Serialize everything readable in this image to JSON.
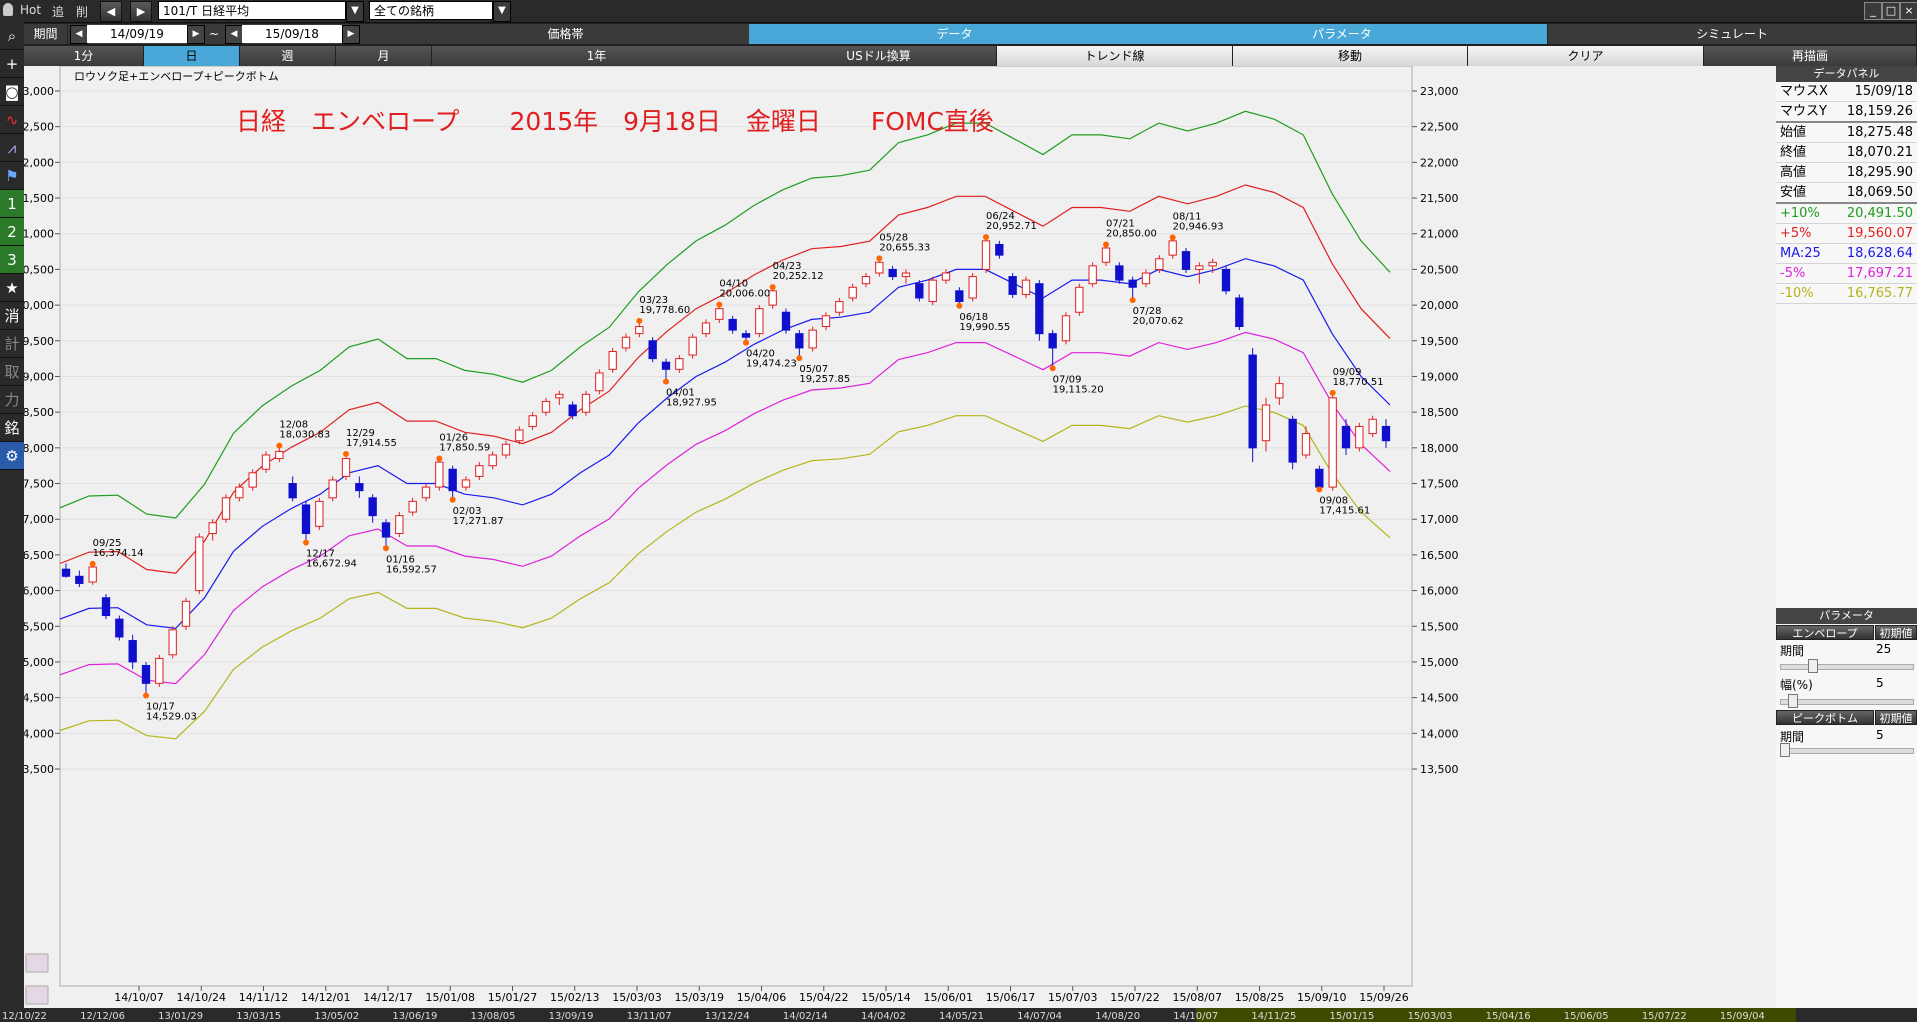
{
  "topbar": {
    "hot": "Hot",
    "tsui": "追",
    "sakujo": "削",
    "symbol": "101/T 日経平均",
    "filter": "全ての銘柄",
    "tab_data": "データ",
    "tab_params": "パラメータ",
    "tab_simulate": "シミュレート"
  },
  "period": {
    "label": "期間",
    "from": "14/09/19",
    "sep": "~",
    "to": "15/09/18",
    "price_band": "価格帯"
  },
  "row3": {
    "b1": "1分",
    "b2": "日",
    "b3": "週",
    "b4": "月",
    "b5": "1年",
    "b6": "USドル換算",
    "b7": "トレンド線",
    "b8": "移動",
    "b9": "クリア",
    "b10": "再描画"
  },
  "left_tools": {
    "t1": "1",
    "t2": "2",
    "t3": "3",
    "t4": "消",
    "t5": "計",
    "t6": "取",
    "t7": "力",
    "t8": "銘"
  },
  "chart": {
    "mode": "ロウソク足+エンベロープ+ピークボトム",
    "title": "日経　エンベロープ　　2015年　9月18日　金曜日　　FOMC直後"
  },
  "colors": {
    "up": "#e02020",
    "down": "#1010cc",
    "ma": "#1a1aee",
    "p5": "#e02020",
    "p10": "#1e9e1e",
    "m5": "#dd22dd",
    "m10": "#b5b51a"
  },
  "chart_data": {
    "type": "candlestick",
    "title": "日経　エンベロープ　　2015年　9月18日　金曜日　　FOMC直後",
    "ylim": [
      13500,
      23000
    ],
    "yticks": [
      "23,000",
      "22,500",
      "22,000",
      "21,500",
      "21,000",
      "20,500",
      "20,000",
      "19,500",
      "19,000",
      "18,500",
      "18,000",
      "17,500",
      "17,000",
      "16,500",
      "16,000",
      "15,500",
      "15,000",
      "14,500",
      "14,000",
      "13,500"
    ],
    "xticks": [
      "14/10/07",
      "14/10/24",
      "14/11/12",
      "14/12/01",
      "14/12/17",
      "15/01/08",
      "15/01/27",
      "15/02/13",
      "15/03/03",
      "15/03/19",
      "15/04/06",
      "15/04/22",
      "15/05/14",
      "15/06/01",
      "15/06/17",
      "15/07/03",
      "15/07/22",
      "15/08/07",
      "15/08/25",
      "15/09/10",
      "15/09/26"
    ],
    "overview_ticks": [
      "12/10/22",
      "12/12/06",
      "13/01/29",
      "13/03/15",
      "13/05/02",
      "13/06/19",
      "13/08/05",
      "13/09/19",
      "13/11/07",
      "13/12/24",
      "14/02/14",
      "14/04/02",
      "14/05/21",
      "14/07/04",
      "14/08/20",
      "14/10/07",
      "14/11/25",
      "15/01/15",
      "15/03/03",
      "15/04/16",
      "15/06/05",
      "15/07/22",
      "15/09/04"
    ],
    "ma_period": 25,
    "ma_series": [
      15600,
      15750,
      15760,
      15520,
      15470,
      15900,
      16550,
      16900,
      17150,
      17350,
      17650,
      17750,
      17500,
      17500,
      17350,
      17300,
      17200,
      17350,
      17650,
      17900,
      18350,
      18700,
      19000,
      19200,
      19450,
      19650,
      19800,
      19830,
      19900,
      20250,
      20350,
      20500,
      20500,
      20300,
      20100,
      20350,
      20350,
      20300,
      20500,
      20400,
      20500,
      20650,
      20550,
      20350,
      19600,
      19000,
      18600
    ],
    "peaks": [
      {
        "date": "09/25",
        "value": "16,374.14"
      },
      {
        "date": "10/17",
        "value": "14,529.03"
      },
      {
        "date": "12/08",
        "value": "18,030.83"
      },
      {
        "date": "12/17",
        "value": "16,672.94"
      },
      {
        "date": "12/29",
        "value": "17,914.55"
      },
      {
        "date": "01/16",
        "value": "16,592.57"
      },
      {
        "date": "01/26",
        "value": "17,850.59"
      },
      {
        "date": "02/03",
        "value": "17,271.87"
      },
      {
        "date": "03/23",
        "value": "19,778.60"
      },
      {
        "date": "04/01",
        "value": "18,927.95"
      },
      {
        "date": "04/10",
        "value": "20,006.00"
      },
      {
        "date": "04/20",
        "value": "19,474.23"
      },
      {
        "date": "04/23",
        "value": "20,252.12"
      },
      {
        "date": "05/07",
        "value": "19,257.85"
      },
      {
        "date": "05/28",
        "value": "20,655.33"
      },
      {
        "date": "06/18",
        "value": "19,990.55"
      },
      {
        "date": "06/24",
        "value": "20,952.71"
      },
      {
        "date": "07/09",
        "value": "19,115.20"
      },
      {
        "date": "07/21",
        "value": "20,850.00"
      },
      {
        "date": "07/28",
        "value": "20,070.62"
      },
      {
        "date": "08/11",
        "value": "20,946.93"
      },
      {
        "date": "09/08",
        "value": "17,415.61"
      },
      {
        "date": "09/09",
        "value": "18,770.51"
      }
    ],
    "peak_values": [
      16374.14,
      14529.03,
      18030.83,
      16672.94,
      17914.55,
      16592.57,
      17850.59,
      17271.87,
      19778.6,
      18927.95,
      20006.0,
      19474.23,
      20252.12,
      19257.85,
      20655.33,
      19990.55,
      20952.71,
      19115.2,
      20850.0,
      20070.62,
      20946.93,
      17415.61,
      18770.51
    ],
    "candles": [
      [
        16300,
        16380,
        16180,
        16200
      ],
      [
        16200,
        16280,
        16050,
        16100
      ],
      [
        16120,
        16374,
        16080,
        16330
      ],
      [
        15900,
        15950,
        15600,
        15650
      ],
      [
        15600,
        15650,
        15300,
        15350
      ],
      [
        15300,
        15380,
        14900,
        15000
      ],
      [
        14950,
        15000,
        14529,
        14700
      ],
      [
        14700,
        15100,
        14650,
        15050
      ],
      [
        15100,
        15500,
        15050,
        15450
      ],
      [
        15500,
        15900,
        15450,
        15850
      ],
      [
        16000,
        16800,
        15950,
        16750
      ],
      [
        16800,
        17000,
        16700,
        16950
      ],
      [
        17000,
        17350,
        16950,
        17300
      ],
      [
        17300,
        17500,
        17250,
        17450
      ],
      [
        17450,
        17700,
        17400,
        17650
      ],
      [
        17700,
        17950,
        17650,
        17900
      ],
      [
        17850,
        18030,
        17800,
        17950
      ],
      [
        17500,
        17600,
        17250,
        17300
      ],
      [
        17200,
        17250,
        16672,
        16800
      ],
      [
        16900,
        17300,
        16850,
        17250
      ],
      [
        17300,
        17600,
        17250,
        17550
      ],
      [
        17600,
        17914,
        17550,
        17850
      ],
      [
        17500,
        17600,
        17300,
        17400
      ],
      [
        17300,
        17350,
        16950,
        17050
      ],
      [
        16950,
        17000,
        16592,
        16750
      ],
      [
        16800,
        17100,
        16750,
        17050
      ],
      [
        17100,
        17300,
        17050,
        17250
      ],
      [
        17300,
        17500,
        17250,
        17450
      ],
      [
        17450,
        17850,
        17400,
        17800
      ],
      [
        17700,
        17750,
        17271,
        17400
      ],
      [
        17450,
        17600,
        17400,
        17550
      ],
      [
        17600,
        17800,
        17550,
        17750
      ],
      [
        17750,
        17950,
        17700,
        17900
      ],
      [
        17900,
        18100,
        17850,
        18050
      ],
      [
        18100,
        18300,
        18050,
        18250
      ],
      [
        18300,
        18500,
        18250,
        18450
      ],
      [
        18500,
        18700,
        18450,
        18650
      ],
      [
        18700,
        18800,
        18600,
        18750
      ],
      [
        18600,
        18650,
        18400,
        18450
      ],
      [
        18500,
        18800,
        18450,
        18750
      ],
      [
        18800,
        19100,
        18750,
        19050
      ],
      [
        19100,
        19400,
        19050,
        19350
      ],
      [
        19400,
        19600,
        19350,
        19550
      ],
      [
        19600,
        19778,
        19550,
        19700
      ],
      [
        19500,
        19550,
        19200,
        19250
      ],
      [
        19200,
        19250,
        18927,
        19100
      ],
      [
        19100,
        19300,
        19050,
        19250
      ],
      [
        19300,
        19600,
        19250,
        19550
      ],
      [
        19600,
        19800,
        19550,
        19750
      ],
      [
        19800,
        20006,
        19750,
        19950
      ],
      [
        19800,
        19850,
        19600,
        19650
      ],
      [
        19600,
        19650,
        19474,
        19550
      ],
      [
        19600,
        20000,
        19550,
        19950
      ],
      [
        20000,
        20252,
        19950,
        20200
      ],
      [
        19900,
        19950,
        19600,
        19650
      ],
      [
        19600,
        19650,
        19257,
        19400
      ],
      [
        19400,
        19700,
        19350,
        19650
      ],
      [
        19700,
        19900,
        19650,
        19850
      ],
      [
        19900,
        20100,
        19850,
        20050
      ],
      [
        20100,
        20300,
        20050,
        20250
      ],
      [
        20300,
        20450,
        20250,
        20400
      ],
      [
        20450,
        20655,
        20400,
        20600
      ],
      [
        20500,
        20550,
        20350,
        20400
      ],
      [
        20400,
        20500,
        20300,
        20450
      ],
      [
        20300,
        20350,
        20050,
        20100
      ],
      [
        20050,
        20400,
        20000,
        20350
      ],
      [
        20350,
        20500,
        20300,
        20450
      ],
      [
        20200,
        20250,
        19990,
        20050
      ],
      [
        20100,
        20450,
        20050,
        20400
      ],
      [
        20500,
        20952,
        20450,
        20900
      ],
      [
        20850,
        20900,
        20650,
        20700
      ],
      [
        20400,
        20450,
        20100,
        20150
      ],
      [
        20150,
        20400,
        20100,
        20350
      ],
      [
        20300,
        20350,
        19500,
        19600
      ],
      [
        19600,
        19650,
        19115,
        19400
      ],
      [
        19500,
        19900,
        19450,
        19850
      ],
      [
        19900,
        20300,
        19850,
        20250
      ],
      [
        20300,
        20600,
        20250,
        20550
      ],
      [
        20600,
        20850,
        20550,
        20800
      ],
      [
        20550,
        20600,
        20300,
        20350
      ],
      [
        20350,
        20400,
        20070,
        20250
      ],
      [
        20300,
        20500,
        20250,
        20450
      ],
      [
        20500,
        20700,
        20450,
        20650
      ],
      [
        20700,
        20946,
        20650,
        20900
      ],
      [
        20750,
        20800,
        20450,
        20500
      ],
      [
        20500,
        20600,
        20300,
        20550
      ],
      [
        20550,
        20650,
        20450,
        20600
      ],
      [
        20500,
        20550,
        20150,
        20200
      ],
      [
        20100,
        20150,
        19650,
        19700
      ],
      [
        19300,
        19400,
        17800,
        18000
      ],
      [
        18100,
        18700,
        17950,
        18600
      ],
      [
        18700,
        19000,
        18600,
        18900
      ],
      [
        18400,
        18450,
        17700,
        17800
      ],
      [
        17900,
        18300,
        17850,
        18200
      ],
      [
        17700,
        17750,
        17415,
        17450
      ],
      [
        17450,
        18770,
        17400,
        18700
      ],
      [
        18300,
        18400,
        17900,
        18000
      ],
      [
        18000,
        18350,
        17950,
        18300
      ],
      [
        18200,
        18450,
        18150,
        18400
      ],
      [
        18300,
        18400,
        18000,
        18100
      ]
    ]
  },
  "panel": {
    "header": "データパネル",
    "mouse_x_label": "マウスX",
    "mouse_x": "15/09/18",
    "mouse_y_label": "マウスY",
    "mouse_y": "18,159.26",
    "open_label": "始値",
    "open": "18,275.48",
    "close_label": "終値",
    "close": "18,070.21",
    "high_label": "高値",
    "high": "18,295.90",
    "low_label": "安値",
    "low": "18,069.50",
    "p10_label": "+10%",
    "p10": "20,491.50",
    "p5_label": "+5%",
    "p5": "19,560.07",
    "ma_label": "MA:25",
    "ma": "18,628.64",
    "m5_label": "-5%",
    "m5": "17,697.21",
    "m10_label": "-10%",
    "m10": "16,765.77",
    "param_header": "パラメータ",
    "env_label": "エンベロープ",
    "reset": "初期値",
    "period_label": "期間",
    "period_val": "25",
    "width_label": "幅(%)",
    "width_val": "5",
    "pb_label": "ピークボトム",
    "reset2": "初期値",
    "pb_period_label": "期間",
    "pb_period_val": "5"
  }
}
